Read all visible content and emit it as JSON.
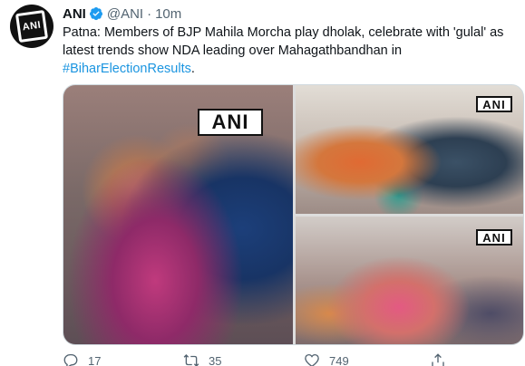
{
  "account": {
    "name": "ANI",
    "handle": "@ANI",
    "separator": "·",
    "time": "10m",
    "avatar_text": "ANI"
  },
  "tweet": {
    "text": "Patna: Members of BJP Mahila Morcha play dholak, celebrate with 'gulal' as latest trends show NDA leading over Mahagathbandhan in ",
    "hashtag": "#BiharElectionResults",
    "trailing": "."
  },
  "media": {
    "watermark": "ANI"
  },
  "actions": {
    "replies": "17",
    "retweets": "35",
    "likes": "749"
  },
  "colors": {
    "link": "#1b95e0",
    "verified": "#1d9bf0",
    "secondary": "#536471"
  },
  "icons": [
    "verified-badge-icon",
    "reply-icon",
    "retweet-icon",
    "like-icon",
    "share-icon"
  ]
}
